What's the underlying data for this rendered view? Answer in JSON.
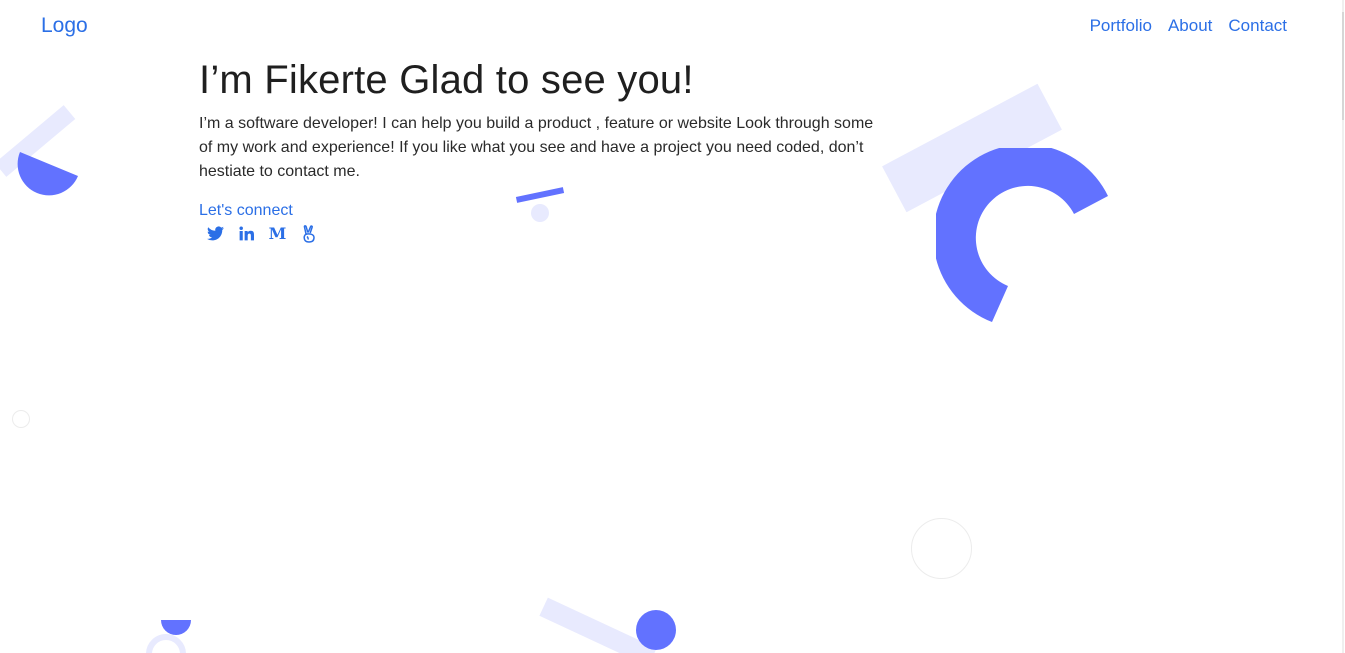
{
  "header": {
    "logo": "Logo",
    "nav": [
      {
        "label": "Portfolio"
      },
      {
        "label": "About"
      },
      {
        "label": "Contact"
      }
    ]
  },
  "hero": {
    "title": "I’m Fikerte Glad to see you!",
    "description": "I’m a software developer! I can help you build a product , feature or website Look through some of my work and experience! If you like what you see and have a project you need coded, don’t hestiate to contact me.",
    "connect_label": "Let's connect",
    "socials": [
      {
        "icon": "twitter-icon"
      },
      {
        "icon": "linkedin-icon"
      },
      {
        "icon": "medium-icon"
      },
      {
        "icon": "angellist-icon"
      }
    ]
  },
  "colors": {
    "accent": "#2b6fe6",
    "shape_primary": "#6272ff",
    "shape_light": "#e8eafe",
    "text": "#1f1f1f"
  }
}
